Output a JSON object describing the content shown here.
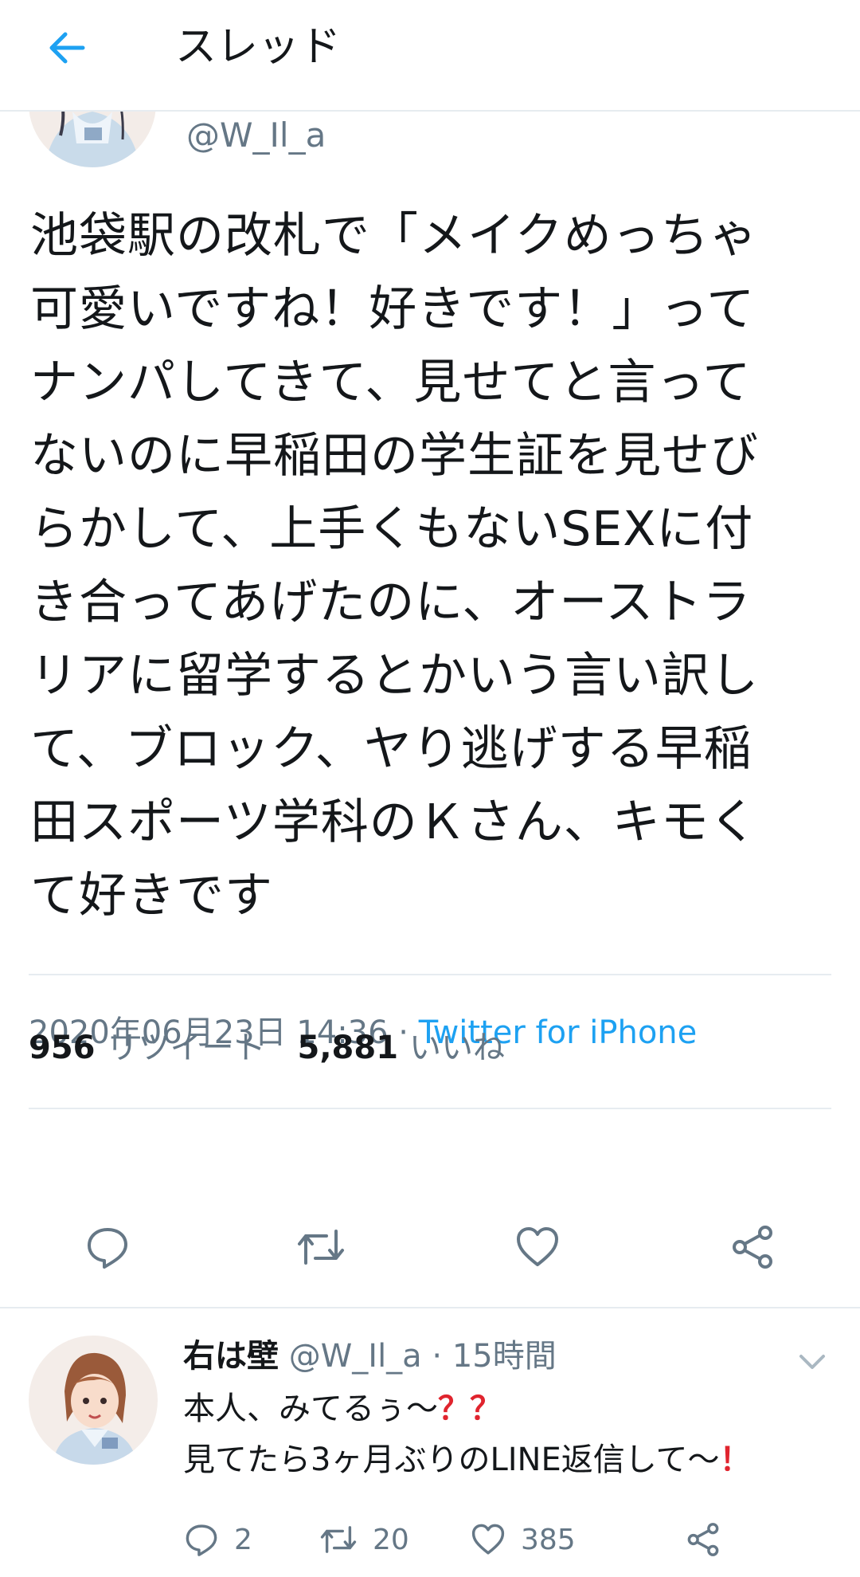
{
  "header": {
    "title": "スレッド"
  },
  "main_tweet": {
    "handle": "@W_Il_a",
    "text_lines": [
      "池袋駅の改札で「メイクめっちゃ",
      "可愛いですね！好きです！」って",
      "ナンパしてきて、見せてと言って",
      "ないのに早稲田の学生証を見せび",
      "らかして、上手くもないSEXに付",
      "き合ってあげたのに、オーストラ",
      "リアに留学するとかいう言い訳し",
      "て、ブロック、ヤり逃げする早稲",
      "田スポーツ学科のＫさん、キモく",
      "て好きです"
    ],
    "date": "2020年06月23日 14:36",
    "separator": " · ",
    "source": "Twitter for iPhone",
    "retweets": "956",
    "retweets_label": "リツイート",
    "likes": "5,881",
    "likes_label": "いいね"
  },
  "reply": {
    "name": "右は壁",
    "handle": "@W_Il_a",
    "dot": " · ",
    "time": "15時間",
    "line1_text": "本人、みてるぅ〜",
    "line1_mark": "？？",
    "line2_text": "見てたら3ヶ月ぶりのLINE返信して〜",
    "line2_mark": "！",
    "reply_count": "2",
    "retweet_count": "20",
    "like_count": "385"
  },
  "colors": {
    "accent": "#1da1f2",
    "secondary_text": "#657786",
    "divider": "#e6ecf0",
    "red_mark": "#e0242e"
  },
  "icons": [
    "back-arrow-icon",
    "reply-icon",
    "retweet-icon",
    "like-icon",
    "share-icon",
    "chevron-down-icon"
  ]
}
